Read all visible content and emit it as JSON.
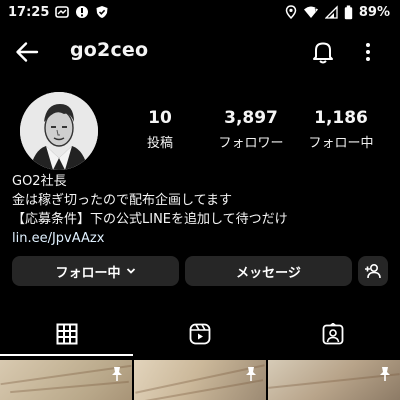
{
  "status_bar": {
    "time": "17:25",
    "battery": "89%"
  },
  "header": {
    "username": "go2ceo"
  },
  "profile": {
    "stats": [
      {
        "num": "10",
        "label": "投稿"
      },
      {
        "num": "3,897",
        "label": "フォロワー"
      },
      {
        "num": "1,186",
        "label": "フォロー中"
      }
    ],
    "bio": {
      "name": "GO2社長",
      "line1": "金は稼ぎ切ったので配布企画してます",
      "line2": "【応募条件】下の公式LINEを追加して待つだけ",
      "link": "lin.ee/JpvAAzx"
    }
  },
  "actions": {
    "follow_label": "フォロー中",
    "message_label": "メッセージ"
  },
  "colors": {
    "background": "#000000",
    "button_bg": "#262626",
    "text": "#f5f5f5"
  }
}
